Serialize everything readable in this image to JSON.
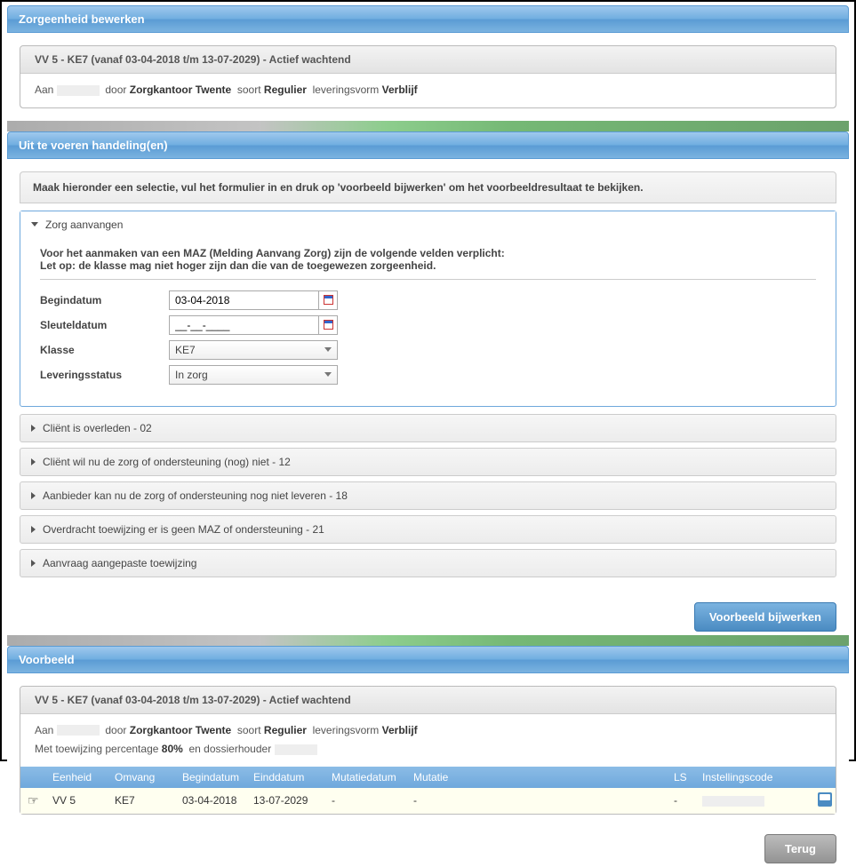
{
  "section1": {
    "title": "Zorgeenheid bewerken",
    "box_head": "VV 5 - KE7 (vanaf  03-04-2018 t/m  13-07-2029) - Actief wachtend",
    "aan_label": "Aan",
    "door_label": "door",
    "door_value": "Zorgkantoor Twente",
    "soort_label": "soort",
    "soort_value": "Regulier",
    "lever_label": "leveringsvorm",
    "lever_value": "Verblijf"
  },
  "section2": {
    "title": "Uit te voeren handeling(en)",
    "instruction": "Maak hieronder een selectie, vul het formulier in en druk op 'voorbeeld bijwerken' om het voorbeeldresultaat te bekijken.",
    "open_accordion": "Zorg aanvangen",
    "note1": "Voor het aanmaken van een MAZ (Melding Aanvang Zorg) zijn de volgende velden verplicht:",
    "note2": "Let op: de klasse mag niet hoger zijn dan die van de toegewezen zorgeenheid.",
    "form": {
      "begindatum_label": "Begindatum",
      "begindatum_value": "03-04-2018",
      "sleuteldatum_label": "Sleuteldatum",
      "sleuteldatum_value": "__-__-____",
      "klasse_label": "Klasse",
      "klasse_value": "KE7",
      "levstatus_label": "Leveringsstatus",
      "levstatus_value": "In zorg"
    },
    "collapsed": [
      "Cliënt is overleden - 02",
      "Cliënt wil nu de zorg of ondersteuning (nog) niet - 12",
      "Aanbieder kan nu de zorg of ondersteuning nog niet leveren - 18",
      "Overdracht toewijzing er is geen MAZ of ondersteuning - 21",
      "Aanvraag aangepaste toewijzing"
    ],
    "update_btn": "Voorbeeld bijwerken"
  },
  "section3": {
    "title": "Voorbeeld",
    "box_head": "VV 5 - KE7 (vanaf  03-04-2018 t/m  13-07-2029) - Actief wachtend",
    "line2": {
      "met": "Met toewijzing percentage",
      "pct": "80%",
      "en": "en dossierhouder"
    },
    "table": {
      "headers": {
        "eenheid": "Eenheid",
        "omvang": "Omvang",
        "begin": "Begindatum",
        "eind": "Einddatum",
        "mutd": "Mutatiedatum",
        "mut": "Mutatie",
        "ls": "LS",
        "inst": "Instellingscode"
      },
      "row": {
        "eenheid": "VV 5",
        "omvang": "KE7",
        "begin": "03-04-2018",
        "eind": "13-07-2029",
        "mutd": "-",
        "mut": "-",
        "ls": "-"
      }
    },
    "back_btn": "Terug"
  }
}
